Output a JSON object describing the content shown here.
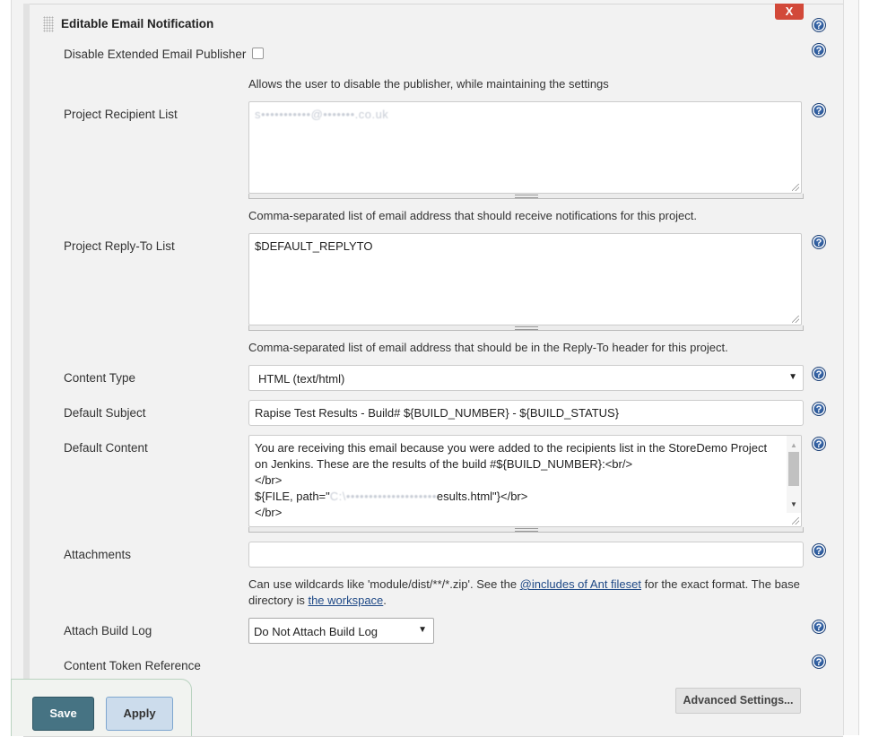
{
  "section": {
    "title": "Editable Email Notification",
    "delete_label": "X"
  },
  "help_icon_glyph": "?",
  "fields": {
    "disable_publisher": {
      "label": "Disable Extended Email Publisher",
      "checked": false,
      "description": "Allows the user to disable the publisher, while maintaining the settings"
    },
    "recipient_list": {
      "label": "Project Recipient List",
      "value": "s•••••••••••@•••••••.co.uk",
      "description": "Comma-separated list of email address that should receive notifications for this project."
    },
    "reply_to_list": {
      "label": "Project Reply-To List",
      "value": "$DEFAULT_REPLYTO",
      "description": "Comma-separated list of email address that should be in the Reply-To header for this project."
    },
    "content_type": {
      "label": "Content Type",
      "selected": "HTML (text/html)"
    },
    "default_subject": {
      "label": "Default Subject",
      "value": "Rapise Test Results - Build# ${BUILD_NUMBER} - ${BUILD_STATUS}"
    },
    "default_content": {
      "label": "Default Content",
      "lines": [
        "You are receiving this email because you were added to the recipients list in the StoreDemo Project",
        "on Jenkins. These are the results of the build #${BUILD_NUMBER}:<br/>",
        "</br>",
        "</br>"
      ],
      "file_line_prefix": "${FILE, path=\"",
      "file_line_blurred": "C:\\••••••••••••••••••••",
      "file_line_suffix": "esults.html\"}</br>"
    },
    "attachments": {
      "label": "Attachments",
      "value": "",
      "description_pre": "Can use wildcards like 'module/dist/**/*.zip'. See the ",
      "link1": "@includes of Ant fileset",
      "description_mid": " for the exact format. The base directory is ",
      "link2": "the workspace",
      "description_post": "."
    },
    "attach_build_log": {
      "label": "Attach Build Log",
      "selected": "Do Not Attach Build Log"
    },
    "content_token_reference": {
      "label": "Content Token Reference"
    }
  },
  "buttons": {
    "advanced": "Advanced Settings...",
    "save": "Save",
    "apply": "Apply"
  },
  "colors": {
    "delete_red": "#d24939",
    "save_teal": "#467383",
    "apply_blue": "#ccdcec",
    "help_blue": "#1f4d8f",
    "link_blue": "#204a87"
  }
}
